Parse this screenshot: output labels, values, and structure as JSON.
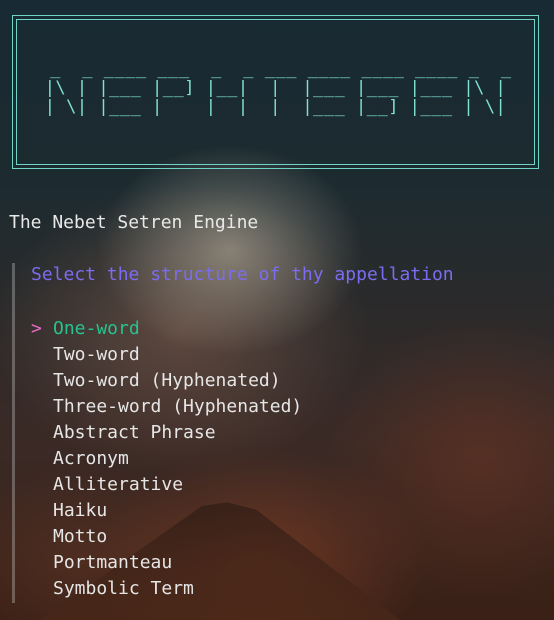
{
  "banner": {
    "ascii": " _  _ ____ ___  _  _ ___ ____ ____ ____ _  _\n|\\ | |___ |__] |__|  |  |___ |___ |___ |\\ |\n| \\| |___ |    |  |  |  |___ |__] |___ | \\|"
  },
  "app": {
    "title": "The Nebet Setren Engine"
  },
  "prompt": {
    "question": "Select the structure of thy appellation",
    "cursor_symbol": ">",
    "selected_index": 0,
    "options": [
      "One-word",
      "Two-word",
      "Two-word (Hyphenated)",
      "Three-word (Hyphenated)",
      "Abstract Phrase",
      "Acronym",
      "Alliterative",
      "Haiku",
      "Motto",
      "Portmanteau",
      "Symbolic Term"
    ]
  },
  "colors": {
    "banner": "#7fe0d2",
    "question": "#7b6cf2",
    "selected": "#27c28f",
    "cursor": "#e66bc2",
    "text": "#e6e6e6"
  }
}
